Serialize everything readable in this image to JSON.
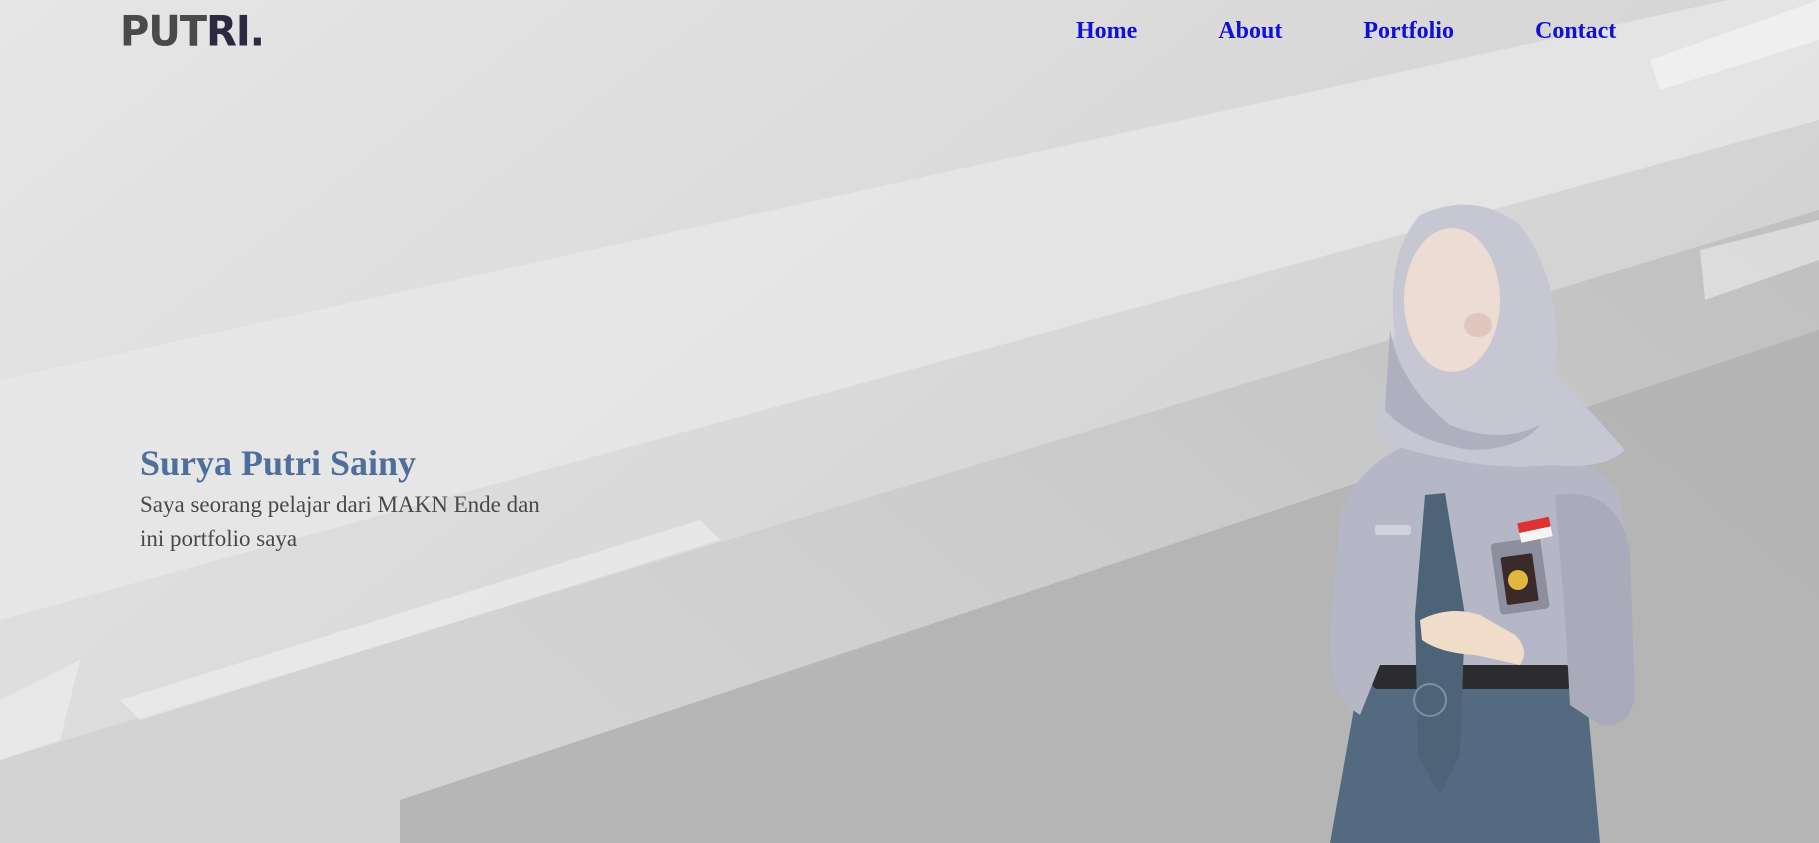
{
  "header": {
    "logo_part1": "PUT",
    "logo_part2": "RI.",
    "nav": [
      {
        "label": "Home"
      },
      {
        "label": "About"
      },
      {
        "label": "Portfolio"
      },
      {
        "label": "Contact"
      }
    ]
  },
  "hero": {
    "name": "Surya Putri Sainy",
    "description": "Saya seorang pelajar dari MAKN Ende dan ini portfolio saya"
  },
  "colors": {
    "nav_link": "#1010d8",
    "name_heading": "#4e6e9b",
    "body_text": "#484848",
    "background": "#d9d9d9"
  },
  "icons": {
    "illustration": "student-hijab-illustration"
  }
}
